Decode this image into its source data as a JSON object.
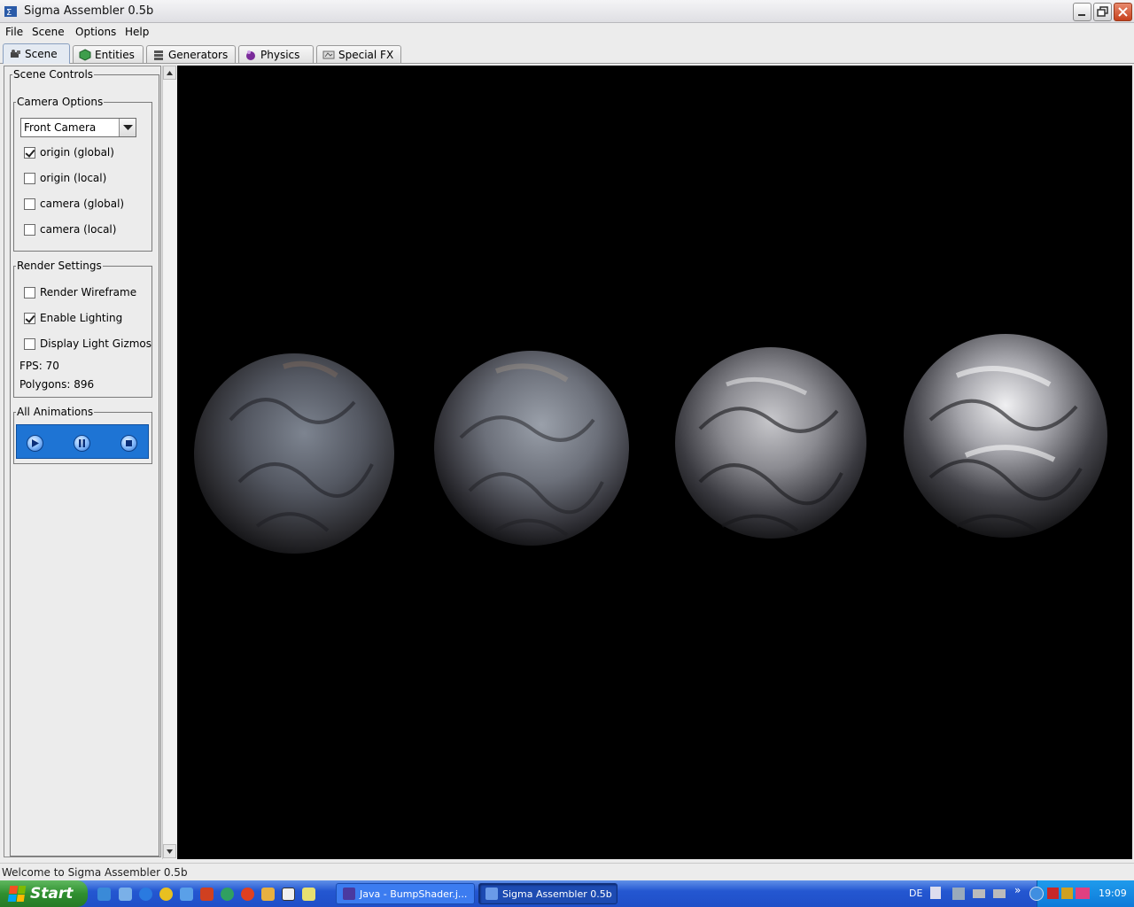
{
  "window": {
    "title": "Sigma Assembler 0.5b"
  },
  "menu": [
    "File",
    "Scene",
    "Options",
    "Help"
  ],
  "tabs": [
    {
      "label": "Scene",
      "icon": "camera-icon",
      "active": true
    },
    {
      "label": "Entities",
      "icon": "cube-icon",
      "active": false
    },
    {
      "label": "Generators",
      "icon": "generator-stack-icon",
      "active": false
    },
    {
      "label": "Physics",
      "icon": "physics-sphere-icon",
      "active": false
    },
    {
      "label": "Special FX",
      "icon": "special-fx-icon",
      "active": false
    }
  ],
  "scene_controls": {
    "title": "Scene Controls",
    "camera_options": {
      "title": "Camera Options",
      "camera_select": "Front Camera",
      "checkboxes": [
        {
          "label": "origin (global)",
          "checked": true
        },
        {
          "label": "origin (local)",
          "checked": false
        },
        {
          "label": "camera (global)",
          "checked": false
        },
        {
          "label": "camera (local)",
          "checked": false
        }
      ]
    },
    "render_settings": {
      "title": "Render Settings",
      "checkboxes": [
        {
          "label": "Render Wireframe",
          "checked": false
        },
        {
          "label": "Enable Lighting",
          "checked": true
        },
        {
          "label": "Display Light Gizmos",
          "checked": false
        }
      ],
      "fps": "FPS: 70",
      "polygons": "Polygons: 896"
    },
    "all_animations": {
      "title": "All Animations",
      "buttons": [
        "play-icon",
        "pause-icon",
        "stop-icon"
      ]
    }
  },
  "viewport": {
    "objects": [
      "bump-mapped-sphere",
      "bump-mapped-sphere",
      "bump-mapped-sphere",
      "bump-mapped-sphere"
    ]
  },
  "status": "Welcome to Sigma Assembler 0.5b",
  "taskbar": {
    "start_label": "Start",
    "tasks": [
      "Java - BumpShader.j...",
      "Sigma Assembler 0.5b"
    ],
    "language": "DE",
    "clock": "19:09"
  },
  "colors": {
    "viewport_bg": "#000000",
    "anim_bar": "#1e74d4",
    "taskbar": "#2457d1",
    "start_green": "#2f8f2f"
  }
}
